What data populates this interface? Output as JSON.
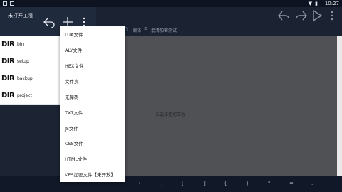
{
  "statusbar": {
    "time": "10:27"
  },
  "left_toolbar": {
    "project_title": "未打开工程"
  },
  "files": [
    {
      "name": "bin",
      "badge": "DIR"
    },
    {
      "name": "setup",
      "badge": "DIR"
    },
    {
      "name": "backup",
      "badge": "DIR"
    },
    {
      "name": "project",
      "badge": "DIR"
    }
  ],
  "editor": {
    "subbar_edit": "编译",
    "subbar_test": "混淆加密测试",
    "empty_text": "未选择任何工程"
  },
  "dropdown": {
    "items": [
      "LUA文件",
      "ALY文件",
      "HEX文件",
      "文件夹",
      "无障碍",
      "TXT文件",
      "JS文件",
      "CSS文件",
      "HTML文件",
      "KES加密文件【未开放】"
    ]
  },
  "bottom_keys": [
    "_",
    "(",
    ")",
    "[",
    "]",
    "{",
    "}",
    "\"",
    "=",
    ".",
    ",",
    ";",
    "_"
  ]
}
